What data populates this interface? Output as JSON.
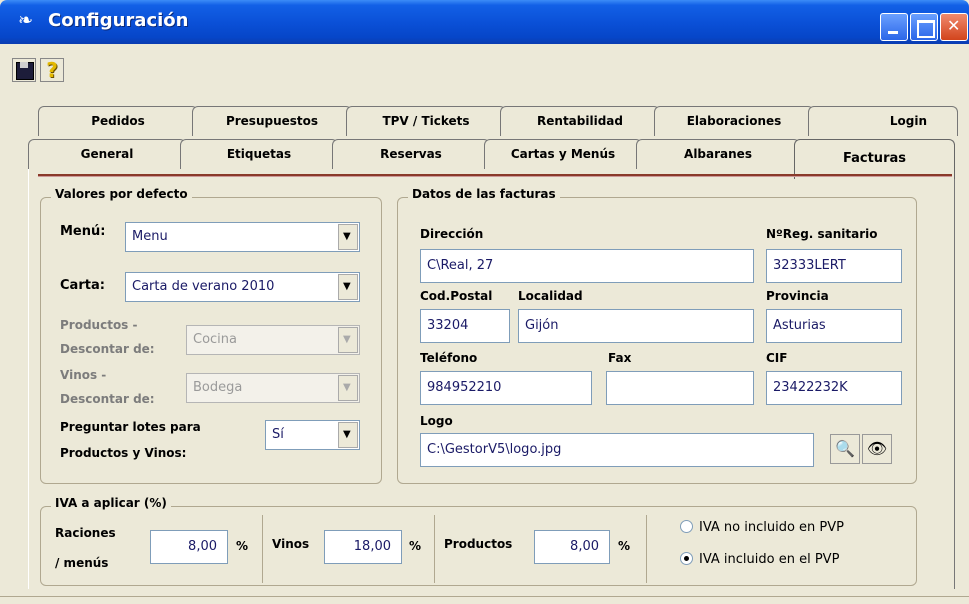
{
  "window": {
    "title": "Configuración",
    "icon": "app-icon"
  },
  "toolbar": {
    "save_icon": "floppy-save-icon",
    "help_icon": "question-help-icon",
    "help_glyph": "?"
  },
  "tabs_back": [
    "Pedidos",
    "Presupuestos",
    "TPV / Tickets",
    "Rentabilidad",
    "Elaboraciones",
    "Login"
  ],
  "tabs_front": [
    "General",
    "Etiquetas",
    "Reservas",
    "Cartas y Menús",
    "Albaranes",
    "Facturas"
  ],
  "active_tab": "Facturas",
  "defaults": {
    "group_title": "Valores por defecto",
    "menu_label": "Menú:",
    "menu_value": "Menu",
    "carta_label": "Carta:",
    "carta_value": "Carta de verano 2010",
    "productos_label_1": "Productos -",
    "productos_label_2": "Descontar de:",
    "productos_value": "Cocina",
    "vinos_label_1": "Vinos -",
    "vinos_label_2": "Descontar de:",
    "vinos_value": "Bodega",
    "lotes_label_1": "Preguntar lotes para",
    "lotes_label_2": "Productos y Vinos:",
    "lotes_value": "Sí"
  },
  "invoice": {
    "group_title": "Datos de las facturas",
    "direccion_label": "Dirección",
    "direccion_value": "C\\Real, 27",
    "reg_label": "NºReg. sanitario",
    "reg_value": "32333LERT",
    "cp_label": "Cod.Postal",
    "cp_value": "33204",
    "localidad_label": "Localidad",
    "localidad_value": "Gijón",
    "provincia_label": "Provincia",
    "provincia_value": "Asturias",
    "telefono_label": "Teléfono",
    "telefono_value": "984952210",
    "fax_label": "Fax",
    "fax_value": "",
    "cif_label": "CIF",
    "cif_value": "23422232K",
    "logo_label": "Logo",
    "logo_value": "C:\\GestorV5\\logo.jpg"
  },
  "iva": {
    "group_title": "IVA a aplicar (%)",
    "raciones_label_1": "Raciones",
    "raciones_label_2": "/ menús",
    "raciones_value": "8,00",
    "vinos_label": "Vinos",
    "vinos_value": "18,00",
    "productos_label": "Productos",
    "productos_value": "8,00",
    "pct": "%",
    "option_no_incluido": "IVA no incluido en PVP",
    "option_incluido": "IVA incluido en el PVP",
    "selected_option": "IVA incluido en el PVP"
  }
}
